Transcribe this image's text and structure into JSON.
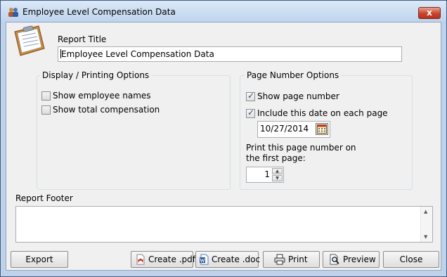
{
  "window": {
    "title": "Employee Level Compensation Data",
    "close_glyph": "x"
  },
  "report": {
    "title_label": "Report Title",
    "title_value": "Employee Level Compensation Data",
    "footer_label": "Report Footer",
    "footer_value": ""
  },
  "display_options": {
    "group_title": "Display / Printing Options",
    "items": [
      {
        "label": "Show employee names",
        "checked": false
      },
      {
        "label": "Show total compensation",
        "checked": false
      }
    ]
  },
  "page_number_options": {
    "group_title": "Page Number Options",
    "show_page_number": {
      "label": "Show page number",
      "checked": true
    },
    "include_date": {
      "label": "Include this date on each page",
      "checked": true
    },
    "date_value": "10/27/2014",
    "first_page_label": "Print this page number on the first page:",
    "first_page_value": "1"
  },
  "buttons": {
    "export": "Export",
    "create_pdf": "Create .pdf",
    "create_doc": "Create .doc",
    "print": "Print",
    "preview": "Preview",
    "close": "Close"
  },
  "icons": {
    "app": "people-icon",
    "clipboard": "clipboard-icon",
    "calendar": "calendar-icon",
    "pdf": "pdf-icon",
    "doc": "word-doc-icon",
    "print": "printer-icon",
    "preview": "magnifier-page-icon"
  },
  "colors": {
    "title_bar": "#c9dbf0",
    "close_button": "#c8442c",
    "client_bg": "#f0f0f0",
    "checkmark": "#2a4d7a"
  }
}
